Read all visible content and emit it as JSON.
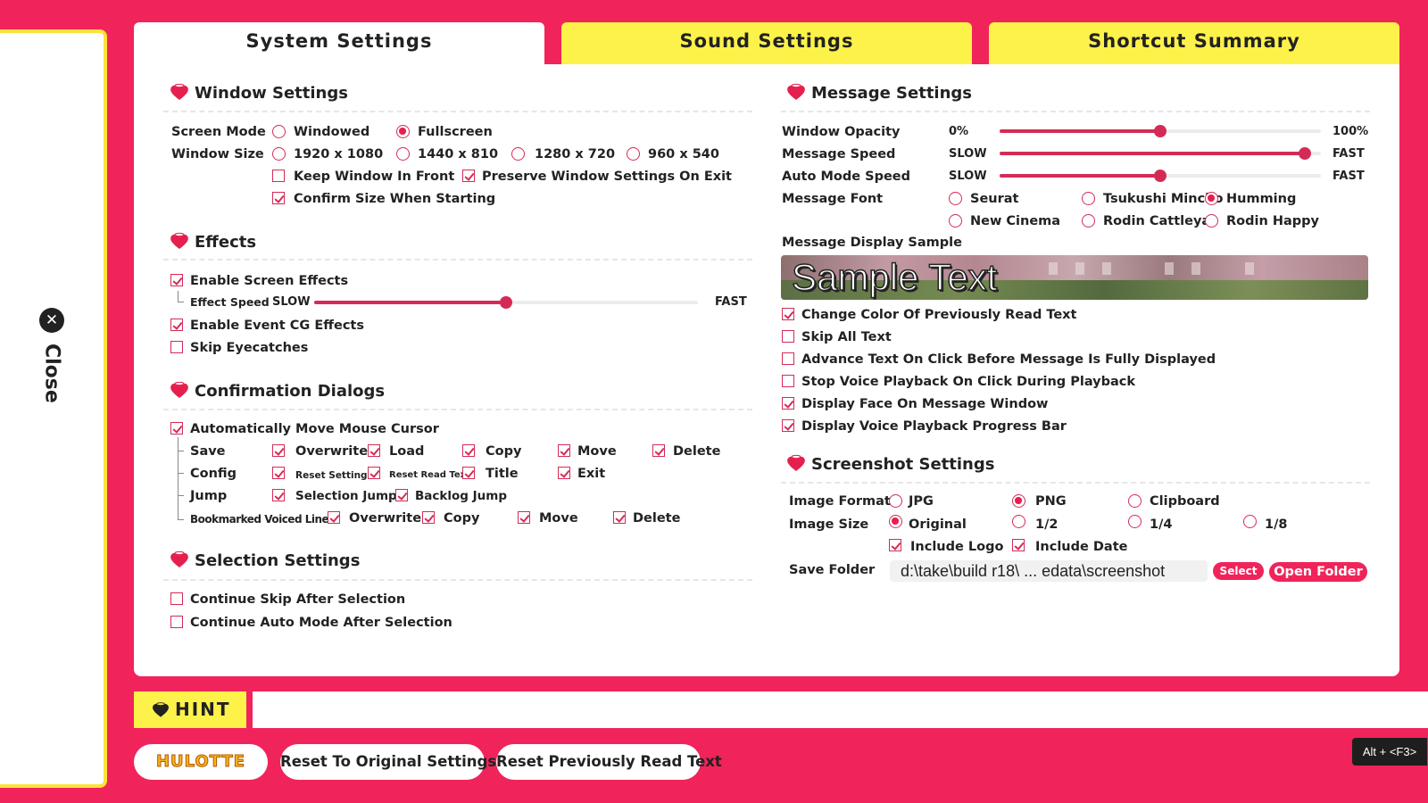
{
  "app": {
    "close_label": "Close",
    "shortcut_hint": "Alt + <F3>"
  },
  "tabs": [
    {
      "label": "System Settings",
      "active": true
    },
    {
      "label": "Sound Settings",
      "active": false
    },
    {
      "label": "Shortcut Summary",
      "active": false
    }
  ],
  "window_settings": {
    "title": "Window Settings",
    "screen_mode_label": "Screen Mode",
    "screen_mode_options": [
      {
        "label": "Windowed",
        "selected": false
      },
      {
        "label": "Fullscreen",
        "selected": true
      }
    ],
    "window_size_label": "Window Size",
    "window_size_options": [
      {
        "label": "1920 x 1080",
        "selected": false
      },
      {
        "label": "1440 x 810",
        "selected": false
      },
      {
        "label": "1280 x 720",
        "selected": false
      },
      {
        "label": "960 x 540",
        "selected": false
      }
    ],
    "keep_in_front": {
      "label": "Keep Window In Front",
      "checked": false
    },
    "preserve_on_exit": {
      "label": "Preserve Window Settings On Exit",
      "checked": true
    },
    "confirm_size": {
      "label": "Confirm Size When Starting",
      "checked": true
    }
  },
  "effects": {
    "title": "Effects",
    "enable_screen": {
      "label": "Enable Screen Effects",
      "checked": true
    },
    "effect_speed": {
      "label": "Effect Speed",
      "min": "SLOW",
      "max": "FAST",
      "value": 0.5
    },
    "enable_event_cg": {
      "label": "Enable Event CG Effects",
      "checked": true
    },
    "skip_eyecatches": {
      "label": "Skip Eyecatches",
      "checked": false
    }
  },
  "confirmation": {
    "title": "Confirmation Dialogs",
    "auto_move_cursor": {
      "label": "Automatically Move Mouse Cursor",
      "checked": true
    },
    "save": {
      "label": "Save",
      "items": [
        {
          "label": "Overwrite",
          "checked": true
        },
        {
          "label": "Load",
          "checked": true
        },
        {
          "label": "Copy",
          "checked": true
        },
        {
          "label": "Move",
          "checked": true
        },
        {
          "label": "Delete",
          "checked": true
        }
      ]
    },
    "config": {
      "label": "Config",
      "items": [
        {
          "label": "Reset Settings",
          "checked": true
        },
        {
          "label": "Reset Read Text",
          "checked": true
        },
        {
          "label": "Title",
          "checked": true
        },
        {
          "label": "Exit",
          "checked": true
        }
      ]
    },
    "jump": {
      "label": "Jump",
      "items": [
        {
          "label": "Selection Jump",
          "checked": true
        },
        {
          "label": "Backlog Jump",
          "checked": true
        }
      ]
    },
    "bookmarked": {
      "label": "Bookmarked Voiced Line",
      "items": [
        {
          "label": "Overwrite",
          "checked": true
        },
        {
          "label": "Copy",
          "checked": true
        },
        {
          "label": "Move",
          "checked": true
        },
        {
          "label": "Delete",
          "checked": true
        }
      ]
    }
  },
  "selection": {
    "title": "Selection Settings",
    "continue_skip": {
      "label": "Continue Skip After Selection",
      "checked": false
    },
    "continue_auto": {
      "label": "Continue Auto Mode After Selection",
      "checked": false
    }
  },
  "message": {
    "title": "Message Settings",
    "opacity": {
      "label": "Window Opacity",
      "min": "0%",
      "max": "100%",
      "value": 0.5
    },
    "msg_speed": {
      "label": "Message Speed",
      "min": "SLOW",
      "max": "FAST",
      "value": 0.95
    },
    "auto_speed": {
      "label": "Auto Mode Speed",
      "min": "SLOW",
      "max": "FAST",
      "value": 0.5
    },
    "font_label": "Message Font",
    "fonts": [
      {
        "label": "Seurat",
        "selected": false
      },
      {
        "label": "Tsukushi Mincho",
        "selected": false
      },
      {
        "label": "Humming",
        "selected": true
      },
      {
        "label": "New Cinema",
        "selected": false
      },
      {
        "label": "Rodin Cattleya",
        "selected": false
      },
      {
        "label": "Rodin Happy",
        "selected": false
      }
    ],
    "sample_label": "Message Display Sample",
    "sample_text": "Sample Text",
    "options": [
      {
        "label": "Change Color Of Previously Read Text",
        "checked": true
      },
      {
        "label": "Skip All Text",
        "checked": false
      },
      {
        "label": "Advance Text On Click Before Message Is Fully Displayed",
        "checked": false
      },
      {
        "label": "Stop Voice Playback On Click During Playback",
        "checked": false
      },
      {
        "label": "Display Face On Message Window",
        "checked": true
      },
      {
        "label": "Display Voice Playback Progress Bar",
        "checked": true
      }
    ]
  },
  "screenshot": {
    "title": "Screenshot Settings",
    "format_label": "Image Format",
    "formats": [
      {
        "label": "JPG",
        "selected": false
      },
      {
        "label": "PNG",
        "selected": true
      },
      {
        "label": "Clipboard",
        "selected": false
      }
    ],
    "size_label": "Image Size",
    "sizes": [
      {
        "label": "Original",
        "selected": true
      },
      {
        "label": "1/2",
        "selected": false
      },
      {
        "label": "1/4",
        "selected": false
      },
      {
        "label": "1/8",
        "selected": false
      }
    ],
    "include_logo": {
      "label": "Include Logo",
      "checked": true
    },
    "include_date": {
      "label": "Include Date",
      "checked": true
    },
    "folder_label": "Save Folder",
    "folder_value": "d:\\take\\build r18\\ ... edata\\screenshot",
    "select_label": "Select",
    "open_label": "Open Folder"
  },
  "bottom": {
    "hint_label": "HINT",
    "logo_text": "HULOTTE",
    "reset_settings": "Reset To Original Settings",
    "reset_read": "Reset Previously Read Text"
  },
  "colors": {
    "accent": "#f0245a",
    "tab_yellow": "#fdf24a",
    "check": "#d42b56"
  }
}
